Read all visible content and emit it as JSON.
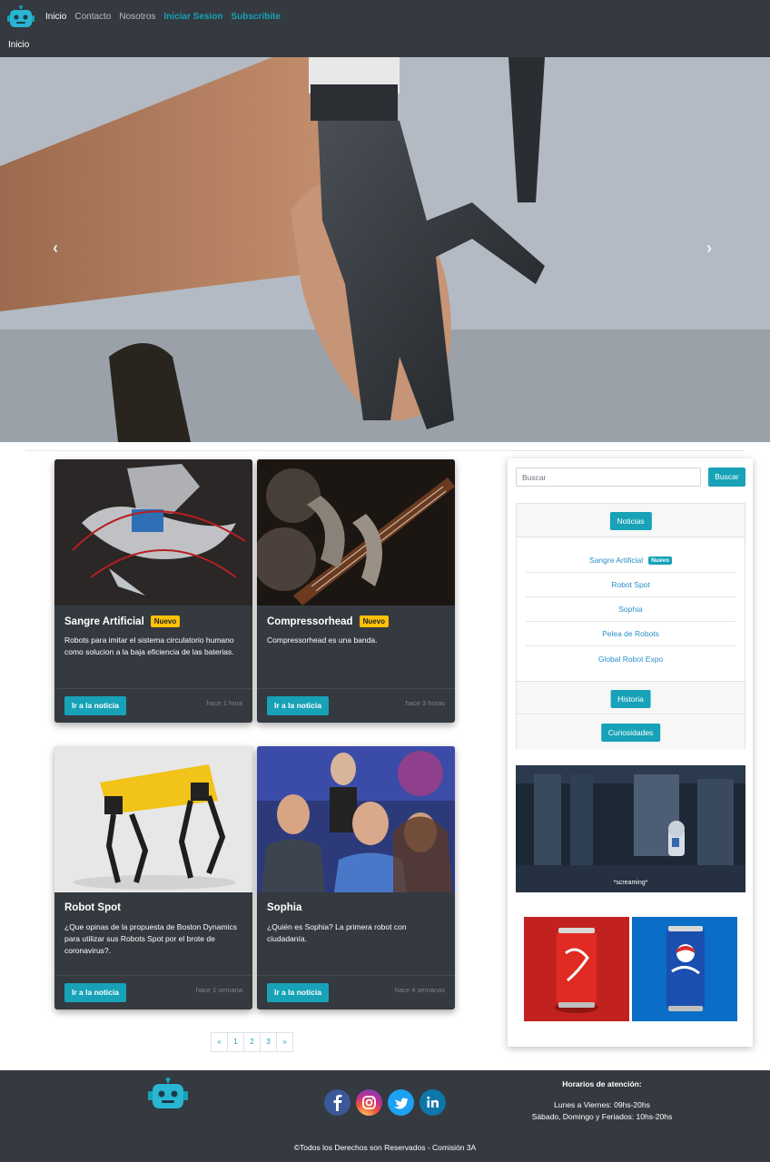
{
  "nav": {
    "logo_icon": "robot-icon",
    "links": [
      "Inicio",
      "Contacto",
      "Nosotros",
      "Iniciar Sesion",
      "Subscribite"
    ],
    "breadcrumb": "Inicio"
  },
  "hero": {
    "prev_symbol": "‹",
    "next_symbol": "›"
  },
  "cards": [
    {
      "title": "Sangre Artificial",
      "badge": "Nuevo",
      "text": "Robots para imitar el sistema circulatorio humano como solucion a la baja eficiencia de las baterias.",
      "button": "Ir a la noticia",
      "time": "hace 1 hora"
    },
    {
      "title": "Compressorhead",
      "badge": "Nuevo",
      "text": "Compressorhead es una banda.",
      "button": "Ir a la noticia",
      "time": "hace 3 horas"
    },
    {
      "title": "Robot Spot",
      "text": "¿Que opinas de la propuesta de Boston Dynamics para utilizar sus Robots Spot por el brote de coronavirus?.",
      "button": "Ir a la noticia",
      "time": "hace 1 semana"
    },
    {
      "title": "Sophia",
      "text": "¿Quién es Sophia? La primera robot con ciudadanía.",
      "button": "Ir a la noticia",
      "time": "hace 4 semanas"
    }
  ],
  "pagination": [
    "«",
    "1",
    "2",
    "3",
    "»"
  ],
  "sidebar": {
    "search_placeholder": "Buscar",
    "search_button": "Buscar",
    "sections": [
      "Noticias",
      "Historia",
      "Curiosidades"
    ],
    "news_items": [
      {
        "label": "Sangre Artificial",
        "badge": "Nuevo"
      },
      {
        "label": "Robot Spot"
      },
      {
        "label": "Sophia"
      },
      {
        "label": "Pelea de Robots"
      },
      {
        "label": "Global Robot Expo"
      }
    ],
    "gif_caption": "*screaming*",
    "ads": [
      "Coca-Cola",
      "Pepsi"
    ]
  },
  "footer": {
    "logo_icon": "robot-icon",
    "social": [
      "facebook-icon",
      "instagram-icon",
      "twitter-icon",
      "linkedin-icon"
    ],
    "hours_title": "Horarios de atención:",
    "hours_line1": "Lunes a Viernes: 09hs-20hs",
    "hours_line2": "Sábado, Domingo y Feriados: 10hs-20hs",
    "copyright": "©Todos los Derechos son Reservados - Comisión 3A"
  },
  "colors": {
    "navbar": "#343a40",
    "accent": "#17a2b8",
    "badge": "#ffc107",
    "link": "#2a8fc9"
  }
}
